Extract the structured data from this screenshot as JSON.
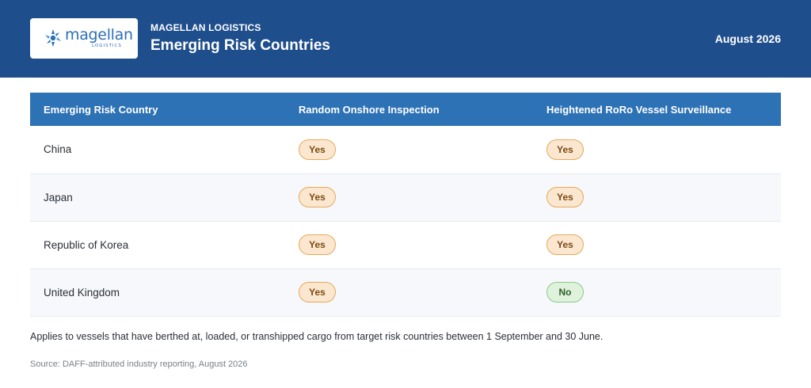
{
  "header": {
    "logo_text": "magellan",
    "logo_subtext": "LOGISTICS",
    "brand": "MAGELLAN LOGISTICS",
    "title": "Emerging Risk Countries",
    "date": "August 2026"
  },
  "table": {
    "columns": [
      "Emerging Risk Country",
      "Random Onshore Inspection",
      "Heightened RoRo Vessel Surveillance"
    ],
    "rows": [
      {
        "country": "China",
        "inspection": "Yes",
        "surveillance": "Yes"
      },
      {
        "country": "Japan",
        "inspection": "Yes",
        "surveillance": "Yes"
      },
      {
        "country": "Republic of Korea",
        "inspection": "Yes",
        "surveillance": "Yes"
      },
      {
        "country": "United Kingdom",
        "inspection": "Yes",
        "surveillance": "No"
      }
    ]
  },
  "note": "Applies to vessels that have berthed at, loaded, or transhipped cargo from target risk countries between 1 September and 30 June.",
  "source": "Source: DAFF-attributed industry reporting, August 2026",
  "colors": {
    "header_bg": "#1f4e8c",
    "table_header_bg": "#2e72b6",
    "yes_bg": "#fbe7cf",
    "no_bg": "#def2dc"
  }
}
